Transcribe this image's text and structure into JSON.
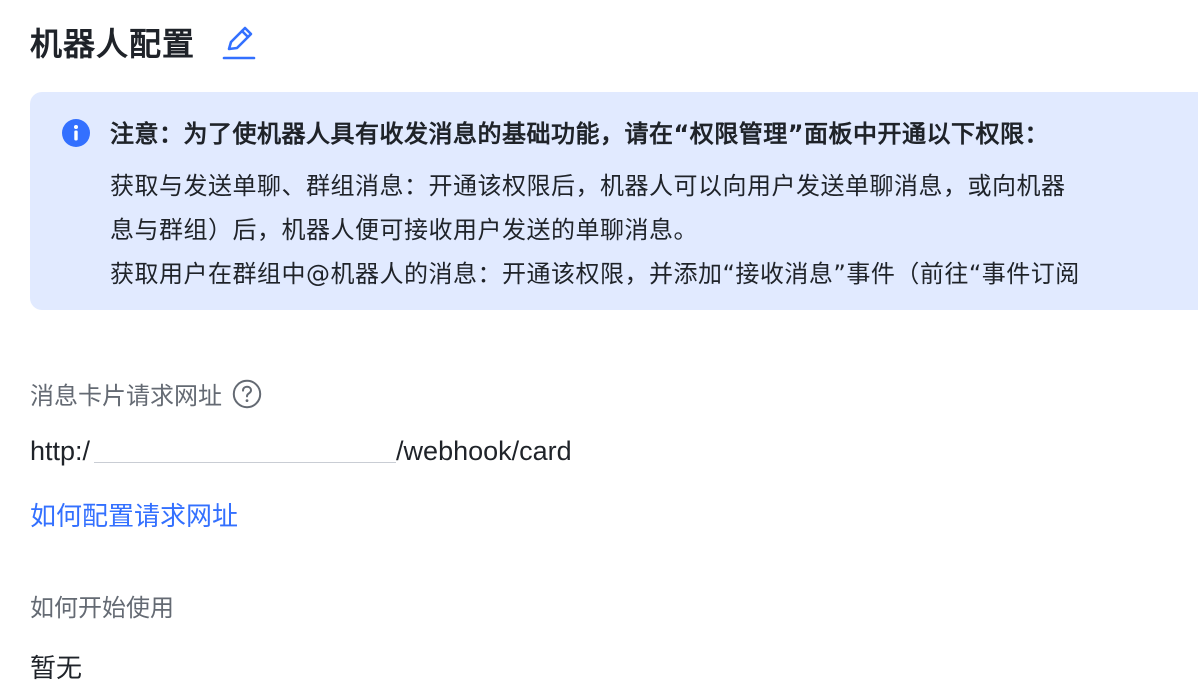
{
  "header": {
    "title": "机器人配置",
    "edit_icon": "edit-pencil-icon"
  },
  "notice": {
    "icon": "info-icon",
    "title": "注意：为了使机器人具有收发消息的基础功能，请在“权限管理”面板中开通以下权限：",
    "line1": "获取与发送单聊、群组消息：开通该权限后，机器人可以向用户发送单聊消息，或向机器",
    "line2": "息与群组）后，机器人便可接收用户发送的单聊消息。",
    "line3": "获取用户在群组中@机器人的消息：开通该权限，并添加“接收消息”事件（前往“事件订阅"
  },
  "card_url": {
    "label": "消息卡片请求网址",
    "help_icon": "question-circle-icon",
    "prefix": "http:/",
    "suffix": "/webhook/card",
    "help_link": "如何配置请求网址"
  },
  "getting_started": {
    "label": "如何开始使用",
    "value": "暂无"
  },
  "colors": {
    "accent": "#3370ff",
    "notice_bg": "#e1eaff",
    "text_primary": "#1f2329",
    "text_secondary": "#646a73"
  }
}
